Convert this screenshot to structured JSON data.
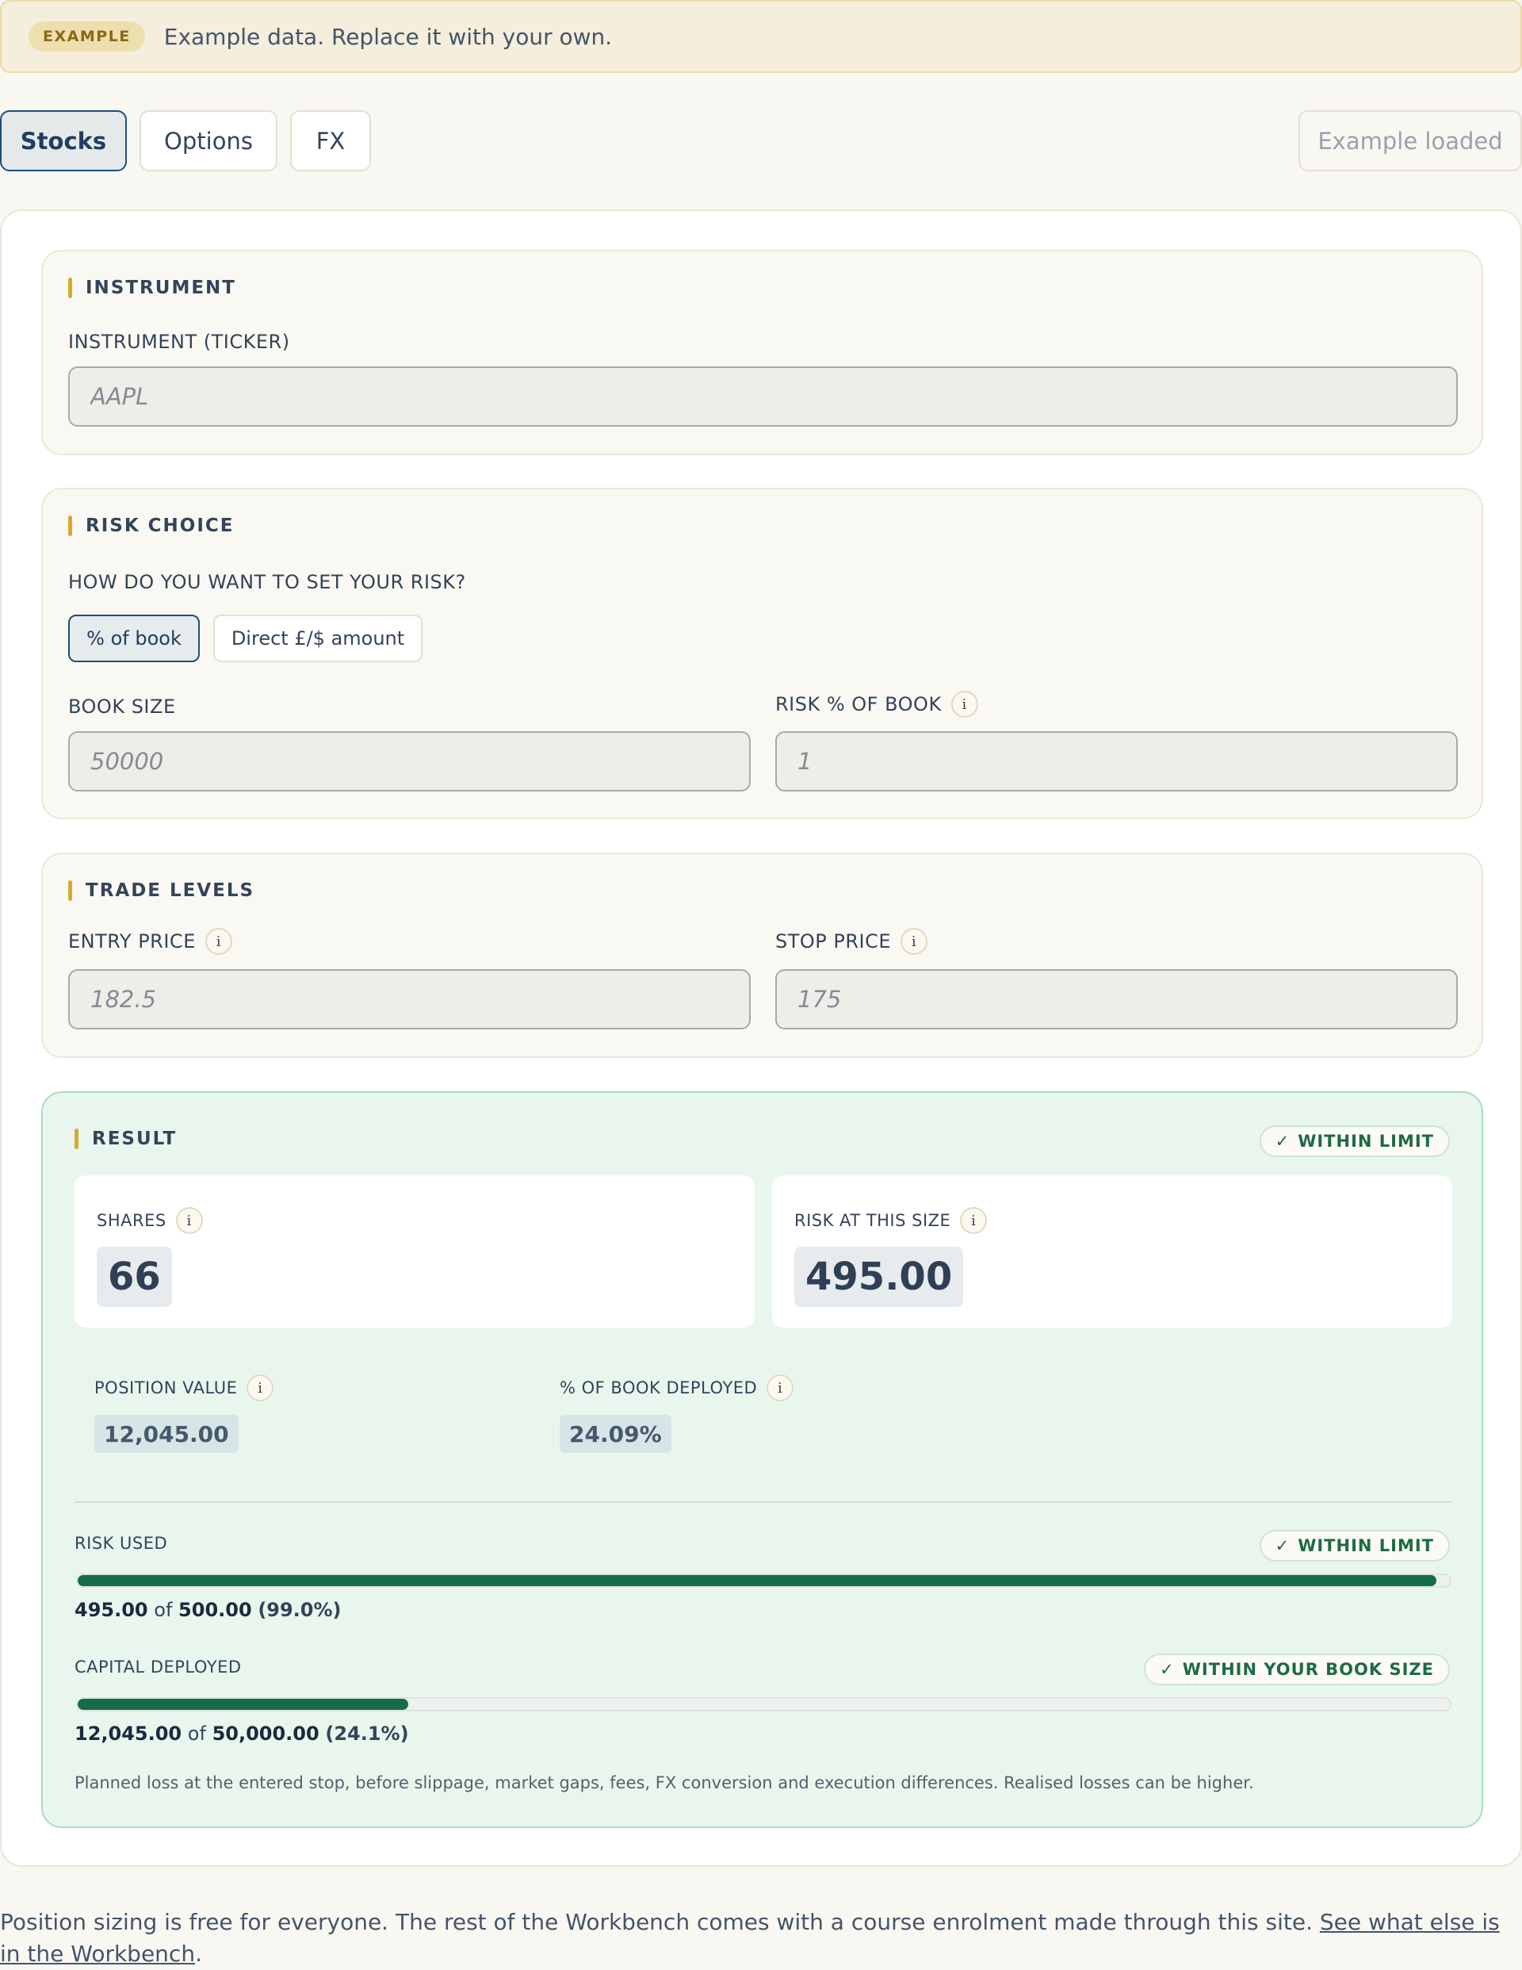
{
  "banner": {
    "badge": "EXAMPLE",
    "message": "Example data. Replace it with your own."
  },
  "tabs": [
    {
      "label": "Stocks",
      "active": true
    },
    {
      "label": "Options",
      "active": false
    },
    {
      "label": "FX",
      "active": false
    }
  ],
  "status_button": "Example loaded",
  "instrument": {
    "title": "INSTRUMENT",
    "ticker_label": "INSTRUMENT (TICKER)",
    "ticker_placeholder": "AAPL"
  },
  "risk_choice": {
    "title": "RISK CHOICE",
    "question": "HOW DO YOU WANT TO SET YOUR RISK?",
    "options": [
      {
        "label": "% of book",
        "active": true
      },
      {
        "label": "Direct £/$ amount",
        "active": false
      }
    ],
    "book_size_label": "BOOK SIZE",
    "book_size_placeholder": "50000",
    "risk_pct_label": "RISK % OF BOOK",
    "risk_pct_placeholder": "1"
  },
  "trade_levels": {
    "title": "TRADE LEVELS",
    "entry_label": "ENTRY PRICE",
    "entry_placeholder": "182.5",
    "stop_label": "STOP PRICE",
    "stop_placeholder": "175"
  },
  "result": {
    "title": "RESULT",
    "status": "WITHIN LIMIT",
    "check": "✓",
    "shares_label": "SHARES",
    "shares_value": "66",
    "risk_label": "RISK AT THIS SIZE",
    "risk_value": "495.00",
    "position_value_label": "POSITION VALUE",
    "position_value": "12,045.00",
    "book_deployed_label": "% OF BOOK DEPLOYED",
    "book_deployed_value": "24.09%",
    "risk_used": {
      "label": "RISK USED",
      "status": "WITHIN LIMIT",
      "used": "495.00",
      "of": "of",
      "total": "500.00",
      "pct_text": "(99.0%)",
      "fraction": 0.99
    },
    "capital_deployed": {
      "label": "CAPITAL DEPLOYED",
      "status": "WITHIN YOUR BOOK SIZE",
      "used": "12,045.00",
      "of": "of",
      "total": "50,000.00",
      "pct_text": "(24.1%)",
      "fraction": 0.241
    },
    "note": "Planned loss at the entered stop, before slippage, market gaps, fees, FX conversion and execution differences. Realised losses can be higher."
  },
  "footer": {
    "text": "Position sizing is free for everyone. The rest of the Workbench comes with a course enrolment made through this site. ",
    "link_text": "See what else is in the Workbench",
    "end": "."
  },
  "info_glyph": "i",
  "colors": {
    "accent": "#d7a930",
    "progress": "#136d48",
    "result_bg": "#e9f6ee",
    "active_tab_border": "#1f4e79"
  }
}
